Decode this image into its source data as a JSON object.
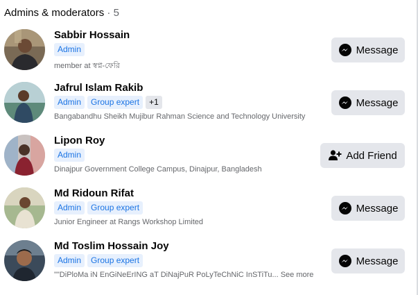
{
  "section": {
    "title": "Admins & moderators",
    "separator": " · ",
    "count": "5"
  },
  "members": [
    {
      "name": "Sabbir Hossain",
      "badges": [
        "Admin"
      ],
      "more_badges": "",
      "subtitle": "member at স্বপ্ন-ফেরি",
      "see_more": "",
      "action": "Message",
      "action_icon": "messenger-icon"
    },
    {
      "name": "Jafrul Islam Rakib",
      "badges": [
        "Admin",
        "Group expert"
      ],
      "more_badges": "+1",
      "subtitle": "Bangabandhu Sheikh Mujibur Rahman Science and Technology University",
      "see_more": "",
      "action": "Message",
      "action_icon": "messenger-icon"
    },
    {
      "name": "Lipon Roy",
      "badges": [
        "Admin"
      ],
      "more_badges": "",
      "subtitle": "Dinajpur Government College Campus, Dinajpur, Bangladesh",
      "see_more": "",
      "action": "Add Friend",
      "action_icon": "add-friend-icon"
    },
    {
      "name": "Md Ridoun Rifat",
      "badges": [
        "Admin",
        "Group expert"
      ],
      "more_badges": "",
      "subtitle": "Junior Engineer at Rangs Workshop Limited",
      "see_more": "",
      "action": "Message",
      "action_icon": "messenger-icon"
    },
    {
      "name": "Md Toslim Hossain Joy",
      "badges": [
        "Admin",
        "Group expert"
      ],
      "more_badges": "",
      "subtitle": "\"\"DiPloMa iN EnGiNeErING aT DiNajPuR PoLyTeChNiC InSTiTu...",
      "see_more": "See more",
      "action": "Message",
      "action_icon": "messenger-icon"
    }
  ],
  "colors": {
    "badge_bg": "#e7f0fd",
    "badge_text": "#1b74e4",
    "button_bg": "#e4e6eb",
    "secondary_text": "#65676b"
  }
}
